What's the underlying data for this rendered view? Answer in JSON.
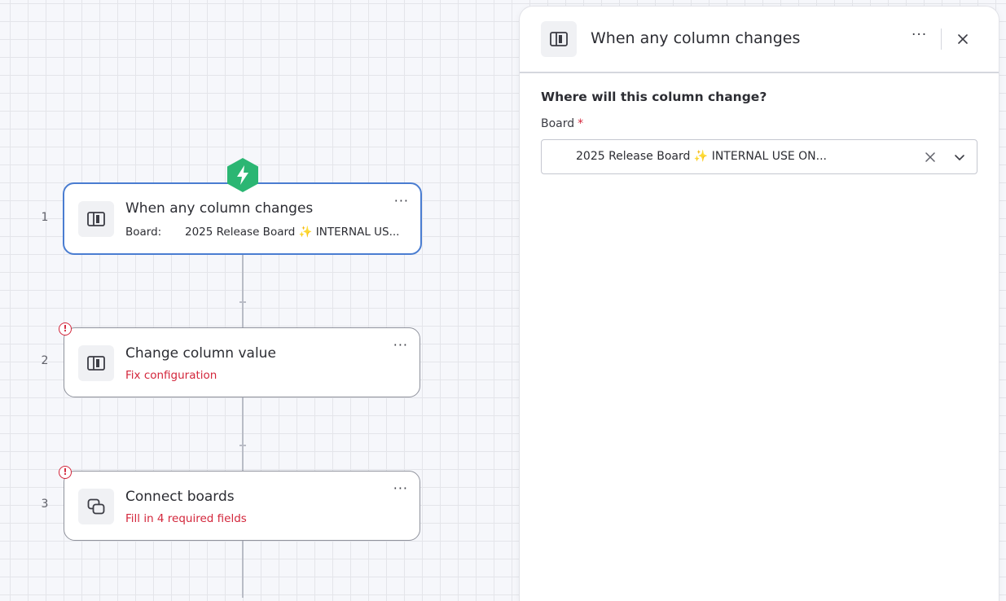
{
  "colors": {
    "accent": "#4a7dd1",
    "error": "#d3263b",
    "trigger_badge": "#2bb673"
  },
  "steps": [
    {
      "number": "1",
      "title": "When any column changes",
      "board_label": "Board:",
      "board_value": "2025 Release Board ✨ INTERNAL US...",
      "icon": "board-icon",
      "more": "···"
    },
    {
      "number": "2",
      "title": "Change column value",
      "status": "Fix configuration",
      "icon": "board-icon",
      "more": "···"
    },
    {
      "number": "3",
      "title": "Connect boards",
      "status": "Fill in 4 required fields",
      "icon": "connect-boards-icon",
      "more": "···"
    }
  ],
  "panel": {
    "title": "When any column changes",
    "more": "···",
    "section_heading": "Where will this column change?",
    "board_field": {
      "label": "Board",
      "required_mark": "*",
      "value": "2025 Release Board ✨ INTERNAL USE ON..."
    }
  }
}
